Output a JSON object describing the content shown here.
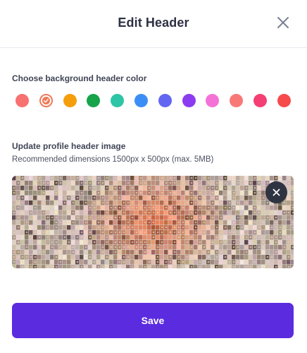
{
  "modal": {
    "title": "Edit Header",
    "close_icon": "close-icon"
  },
  "color_section": {
    "label": "Choose background header color",
    "selected_index": 1,
    "swatches": [
      {
        "name": "coral-red",
        "color": "#f87171"
      },
      {
        "name": "coral-selected",
        "color": "#f07857"
      },
      {
        "name": "orange",
        "color": "#f59e0b"
      },
      {
        "name": "green",
        "color": "#16a34a"
      },
      {
        "name": "teal",
        "color": "#2ec4a6"
      },
      {
        "name": "blue",
        "color": "#3b8ef5"
      },
      {
        "name": "indigo",
        "color": "#6366f1"
      },
      {
        "name": "violet",
        "color": "#8b3cf0"
      },
      {
        "name": "pink",
        "color": "#f472d6"
      },
      {
        "name": "salmon",
        "color": "#f87878"
      },
      {
        "name": "rose",
        "color": "#f43f74"
      },
      {
        "name": "red",
        "color": "#f74a4a"
      }
    ]
  },
  "image_section": {
    "label": "Update profile header image",
    "hint": "Recommended dimensions 1500px x 500px (max. 5MB)",
    "remove_icon": "close-icon"
  },
  "save_button": {
    "label": "Save",
    "color": "#5b2be0"
  }
}
